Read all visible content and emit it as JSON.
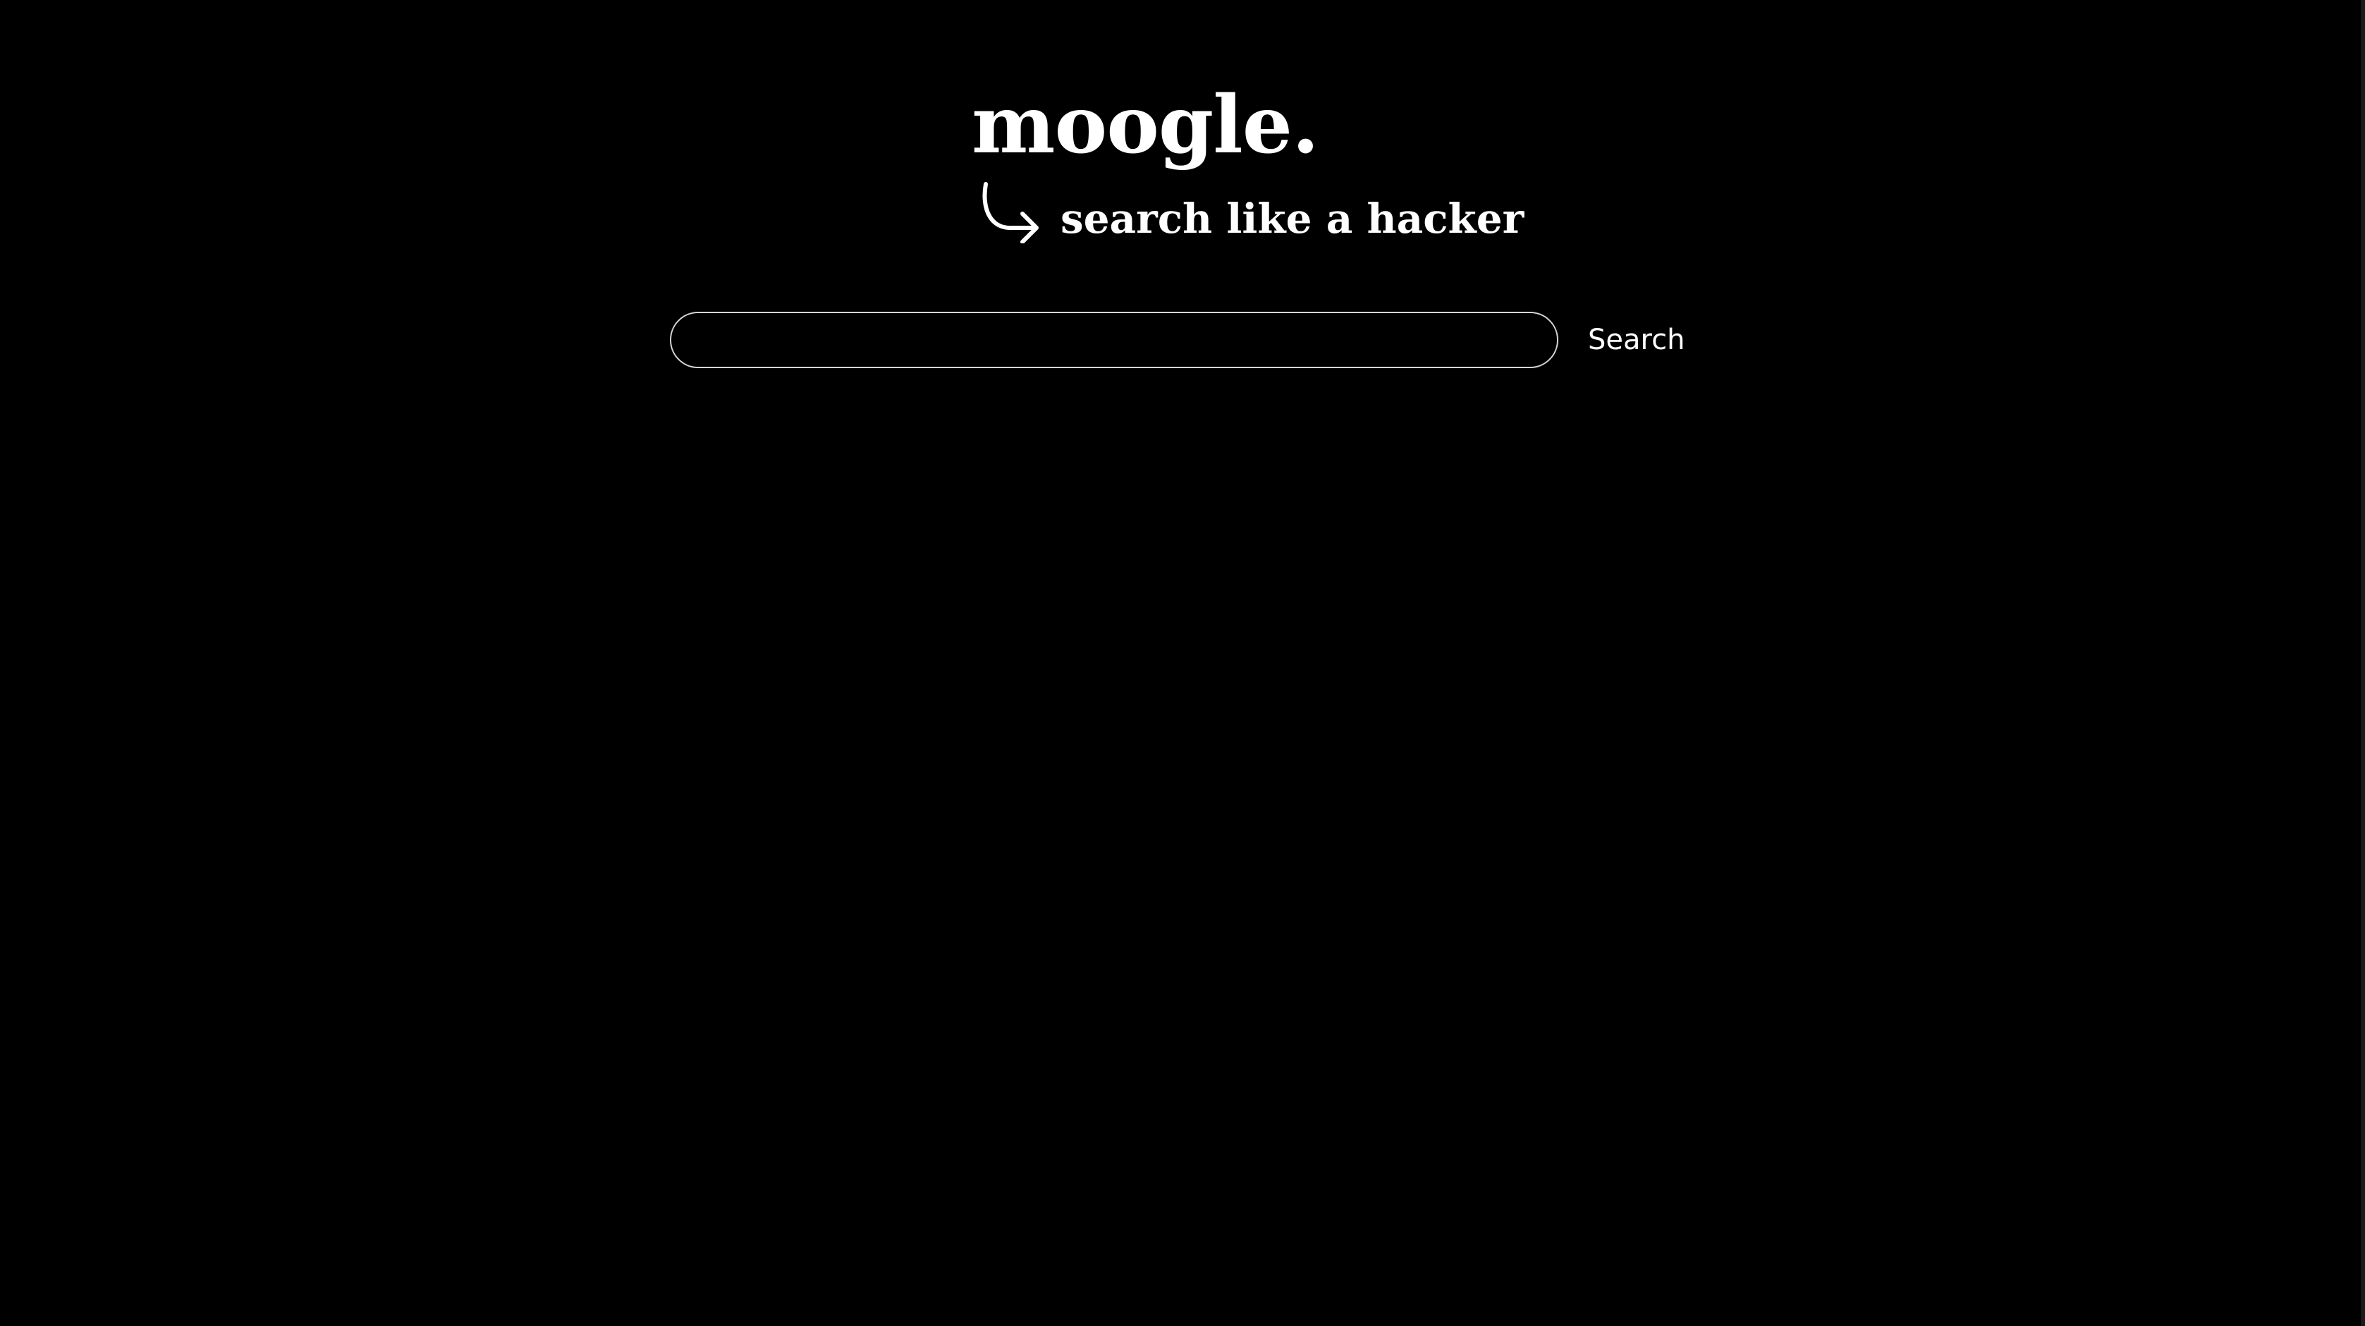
{
  "header": {
    "logo_text": "moogle.",
    "tagline": "search like a hacker",
    "tagline_icon": "curved-arrow-right-icon"
  },
  "search": {
    "value": "",
    "placeholder": "",
    "button_label": "Search"
  },
  "colors": {
    "background": "#000000",
    "foreground": "#ffffff",
    "input_border": "#d6d6d6"
  }
}
